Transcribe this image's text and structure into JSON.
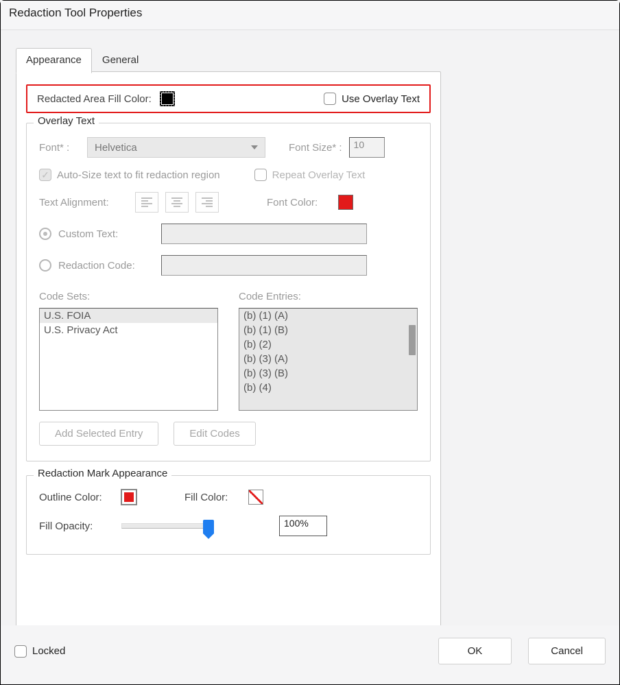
{
  "dialog": {
    "title": "Redaction Tool Properties"
  },
  "tabs": {
    "appearance": "Appearance",
    "general": "General"
  },
  "fillcolor": {
    "label": "Redacted Area Fill Color:",
    "use_overlay": "Use Overlay Text"
  },
  "overlay": {
    "legend": "Overlay Text",
    "font_label": "Font* :",
    "font_value": "Helvetica",
    "fontsize_label": "Font Size* :",
    "fontsize_value": "10",
    "autosize": "Auto-Size text to fit redaction region",
    "repeat": "Repeat Overlay Text",
    "align_label": "Text Alignment:",
    "fontcolor_label": "Font Color:",
    "custom_text_label": "Custom Text:",
    "redaction_code_label": "Redaction Code:",
    "codesets_label": "Code Sets:",
    "codesets": [
      "U.S. FOIA",
      "U.S. Privacy Act"
    ],
    "codeentries_label": "Code Entries:",
    "codeentries": [
      "(b) (1) (A)",
      "(b) (1) (B)",
      "(b) (2)",
      "(b) (3) (A)",
      "(b) (3) (B)",
      "(b) (4)"
    ],
    "add_entry_btn": "Add Selected Entry",
    "edit_codes_btn": "Edit Codes"
  },
  "mark": {
    "legend": "Redaction Mark Appearance",
    "outline_label": "Outline Color:",
    "fillcolor_label": "Fill Color:",
    "opacity_label": "Fill Opacity:",
    "opacity_value": "100%"
  },
  "bottom": {
    "locked": "Locked",
    "ok": "OK",
    "cancel": "Cancel"
  },
  "colors": {
    "accent_red": "#e21a1a",
    "slider_blue": "#1f7ef0"
  }
}
